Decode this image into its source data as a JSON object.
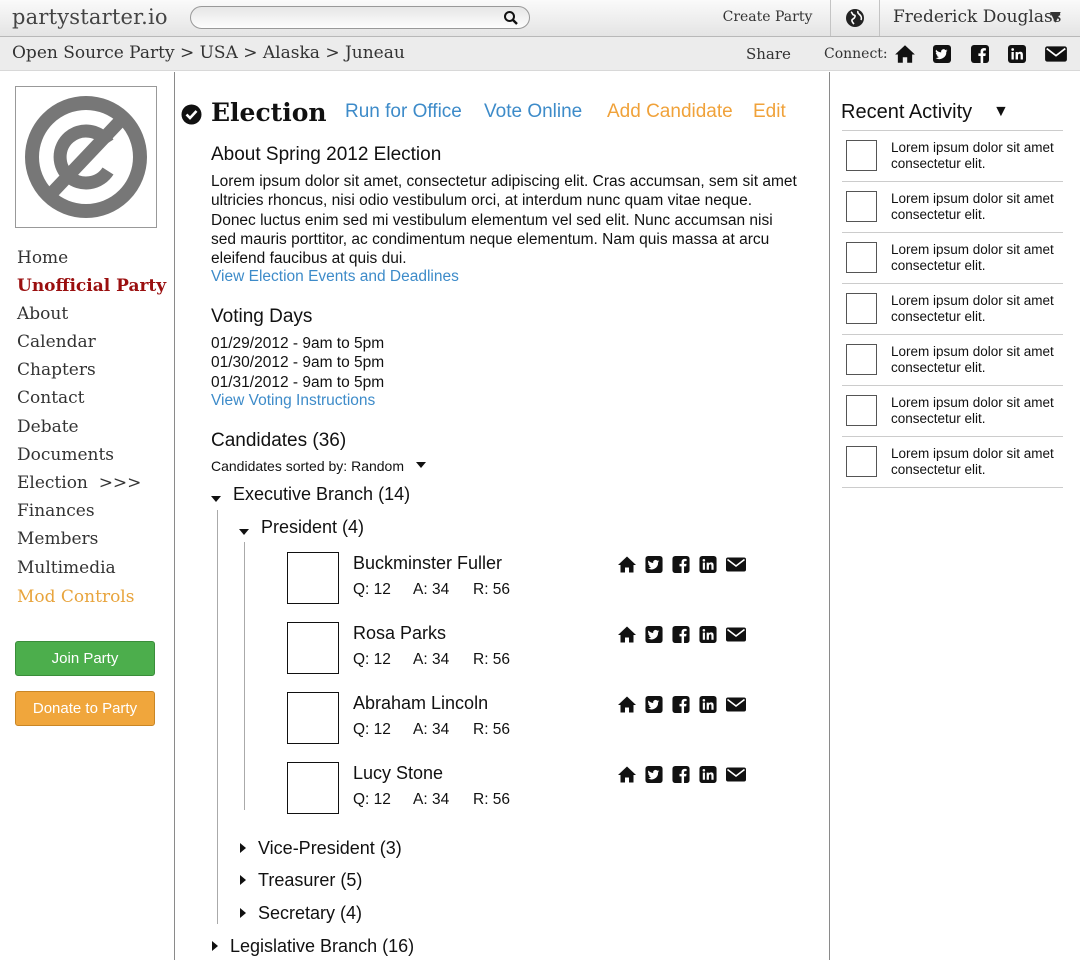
{
  "topbar": {
    "logo": "partystarter.io",
    "search_placeholder": "",
    "create_party": "Create Party",
    "user": "Frederick Douglass",
    "user_caret": "▼"
  },
  "crumbs": {
    "path": "Open Source Party > USA > Alaska > Juneau",
    "share": "Share",
    "connect": "Connect:",
    "icons": [
      "home-icon",
      "twitter-icon",
      "facebook-icon",
      "linkedin-icon",
      "email-icon"
    ]
  },
  "sidebar": {
    "items": [
      {
        "label": "Home"
      },
      {
        "label": "Unofficial Party"
      },
      {
        "label": "About"
      },
      {
        "label": "Calendar"
      },
      {
        "label": "Chapters"
      },
      {
        "label": "Contact"
      },
      {
        "label": "Debate"
      },
      {
        "label": "Documents"
      },
      {
        "label": "Election  >>>"
      },
      {
        "label": "Finances"
      },
      {
        "label": "Members"
      },
      {
        "label": "Multimedia"
      },
      {
        "label": "Mod Controls"
      }
    ],
    "join": "Join Party",
    "donate": "Donate to Party"
  },
  "main": {
    "title": "Election",
    "links": {
      "run": "Run for Office",
      "vote": "Vote Online",
      "add": "Add Candidate",
      "edit": "Edit"
    },
    "about_title": "About Spring 2012 Election",
    "about_text": "Lorem ipsum dolor sit amet, consectetur adipiscing elit. Cras accumsan, sem sit amet ultricies rhoncus, nisi odio vestibulum orci, at interdum nunc quam vitae neque. Donec luctus enim sed mi vestibulum elementum vel sed elit. Nunc accumsan nisi sed mauris porttitor, ac condimentum neque elementum. Nam quis massa at arcu eleifend faucibus at quis dui.",
    "events_link": "View Election Events and Deadlines",
    "voting_title": "Voting Days",
    "voting_days": [
      "01/29/2012 - 9am to 5pm",
      "01/30/2012 - 9am to 5pm",
      "01/31/2012 - 9am to 5pm"
    ],
    "voting_link": "View Voting Instructions",
    "candidates_title": "Candidates (36)",
    "sorted_by": "Candidates sorted by: Random",
    "branches": {
      "executive": "Executive Branch (14)",
      "president": "President (4)",
      "vice": "Vice-President (3)",
      "treasurer": "Treasurer (5)",
      "secretary": "Secretary (4)",
      "legislative": "Legislative Branch (16)"
    },
    "candidates": [
      {
        "name": "Buckminster Fuller",
        "q": "Q: 12",
        "a": "A: 34",
        "r": "R: 56"
      },
      {
        "name": "Rosa Parks",
        "q": "Q: 12",
        "a": "A: 34",
        "r": "R: 56"
      },
      {
        "name": "Abraham Lincoln",
        "q": "Q: 12",
        "a": "A: 34",
        "r": "R: 56"
      },
      {
        "name": "Lucy Stone",
        "q": "Q: 12",
        "a": "A: 34",
        "r": "R: 56"
      }
    ]
  },
  "recent": {
    "title": "Recent Activity",
    "caret": "▼",
    "items": [
      "Lorem ipsum dolor sit amet consectetur elit.",
      "Lorem ipsum dolor sit amet consectetur elit.",
      "Lorem ipsum dolor sit amet consectetur elit.",
      "Lorem ipsum dolor sit amet consectetur elit.",
      "Lorem ipsum dolor sit amet consectetur elit.",
      "Lorem ipsum dolor sit amet consectetur elit.",
      "Lorem ipsum dolor sit amet consectetur elit."
    ]
  },
  "colors": {
    "link_blue": "#3d8bc9",
    "link_orange": "#f0a23a",
    "party_red": "#9a0f0f",
    "join_green": "#4cae4c",
    "donate_orange": "#f0a63c"
  }
}
